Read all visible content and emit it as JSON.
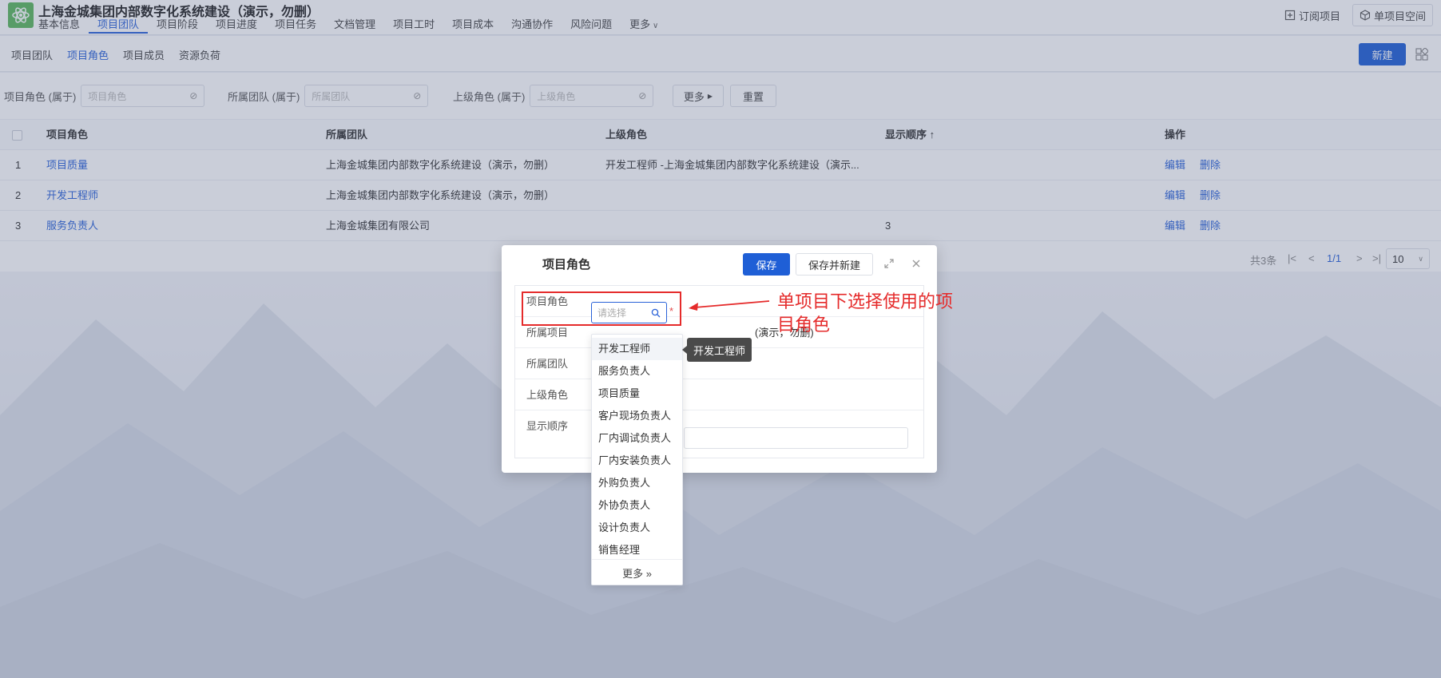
{
  "header": {
    "project_title": "上海金城集团内部数字化系统建设（演示，勿删）",
    "nav": [
      "基本信息",
      "项目团队",
      "项目阶段",
      "项目进度",
      "项目任务",
      "文档管理",
      "项目工时",
      "项目成本",
      "沟通协作",
      "风险问题",
      "更多"
    ],
    "subscribe_label": "订阅项目",
    "space_label": "单项目空间"
  },
  "subnav": {
    "tabs": [
      "项目团队",
      "项目角色",
      "项目成员",
      "资源负荷"
    ],
    "new_label": "新建"
  },
  "filters": {
    "role_label": "项目角色 (属于)",
    "role_placeholder": "项目角色",
    "team_label": "所属团队 (属于)",
    "team_placeholder": "所属团队",
    "parent_label": "上级角色 (属于)",
    "parent_placeholder": "上级角色",
    "more_label": "更多",
    "reset_label": "重置"
  },
  "table": {
    "columns": [
      "项目角色",
      "所属团队",
      "上级角色",
      "显示顺序",
      "操作"
    ],
    "sort_indicator": "↑",
    "rows": [
      {
        "no": "1",
        "role": "项目质量",
        "team": "上海金城集团内部数字化系统建设（演示，勿删）",
        "parent": "开发工程师 -上海金城集团内部数字化系统建设（演示...",
        "order": ""
      },
      {
        "no": "2",
        "role": "开发工程师",
        "team": "上海金城集团内部数字化系统建设（演示，勿删）",
        "parent": "",
        "order": ""
      },
      {
        "no": "3",
        "role": "服务负责人",
        "team": "上海金城集团有限公司",
        "parent": "",
        "order": "3"
      }
    ],
    "edit_label": "编辑",
    "delete_label": "删除",
    "pager": {
      "total": "共3条",
      "page": "1/1",
      "page_size": "10"
    }
  },
  "dialog": {
    "title": "项目角色",
    "save_label": "保存",
    "save_new_label": "保存并新建",
    "fields": {
      "role_label": "项目角色",
      "role_placeholder": "请选择",
      "project_label": "所属项目",
      "project_value_tail": "(演示，勿删)",
      "team_label": "所属团队",
      "parent_label": "上级角色",
      "order_label": "显示顺序"
    },
    "required_mark": "*",
    "dropdown": {
      "options": [
        "开发工程师",
        "服务负责人",
        "项目质量",
        "客户现场负责人",
        "厂内调试负责人",
        "厂内安装负责人",
        "外购负责人",
        "外协负责人",
        "设计负责人",
        "销售经理"
      ],
      "more_label": "更多 »",
      "tooltip": "开发工程师"
    }
  },
  "annotation": {
    "text": "单项目下选择使用的项目角色"
  },
  "colors": {
    "primary": "#1f5fd6",
    "link": "#2a62d8",
    "annotation": "#e52b2b"
  }
}
